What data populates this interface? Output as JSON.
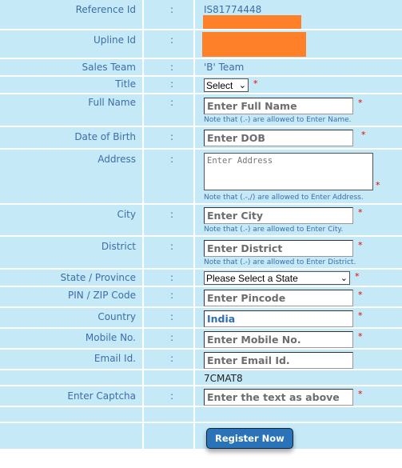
{
  "form": {
    "reference_id": {
      "label": "Reference Id",
      "value": "IS81774448"
    },
    "upline_id": {
      "label": "Upline Id"
    },
    "sales_team": {
      "label": "Sales Team",
      "value": "'B' Team"
    },
    "title": {
      "label": "Title",
      "selected": "Select"
    },
    "full_name": {
      "label": "Full Name",
      "placeholder": "Enter Full Name",
      "note": "Note that (.-) are allowed to Enter Name."
    },
    "dob": {
      "label": "Date of Birth",
      "placeholder": "Enter DOB"
    },
    "address": {
      "label": "Address",
      "placeholder": "Enter Address",
      "note": "Note that (.-,/) are allowed to Enter Address."
    },
    "city": {
      "label": "City",
      "placeholder": "Enter City",
      "note": "Note that (.-) are allowed to Enter City."
    },
    "district": {
      "label": "District",
      "placeholder": "Enter District",
      "note": "Note that (.-) are allowed to Enter District."
    },
    "state": {
      "label": "State / Province",
      "selected": "Please Select a State"
    },
    "pin": {
      "label": "PIN / ZIP Code",
      "placeholder": "Enter Pincode"
    },
    "country": {
      "label": "Country",
      "value": "India"
    },
    "mobile": {
      "label": "Mobile No.",
      "placeholder": "Enter Mobile No."
    },
    "email": {
      "label": "Email Id.",
      "placeholder": "Enter Email Id."
    },
    "captcha_text": "7CMAT8",
    "captcha": {
      "label": "Enter Captcha",
      "placeholder": "Enter the text as above"
    },
    "colon": ":",
    "required_mark": "*",
    "dropdown_glyph": "⌄",
    "submit_label": "Register Now"
  }
}
